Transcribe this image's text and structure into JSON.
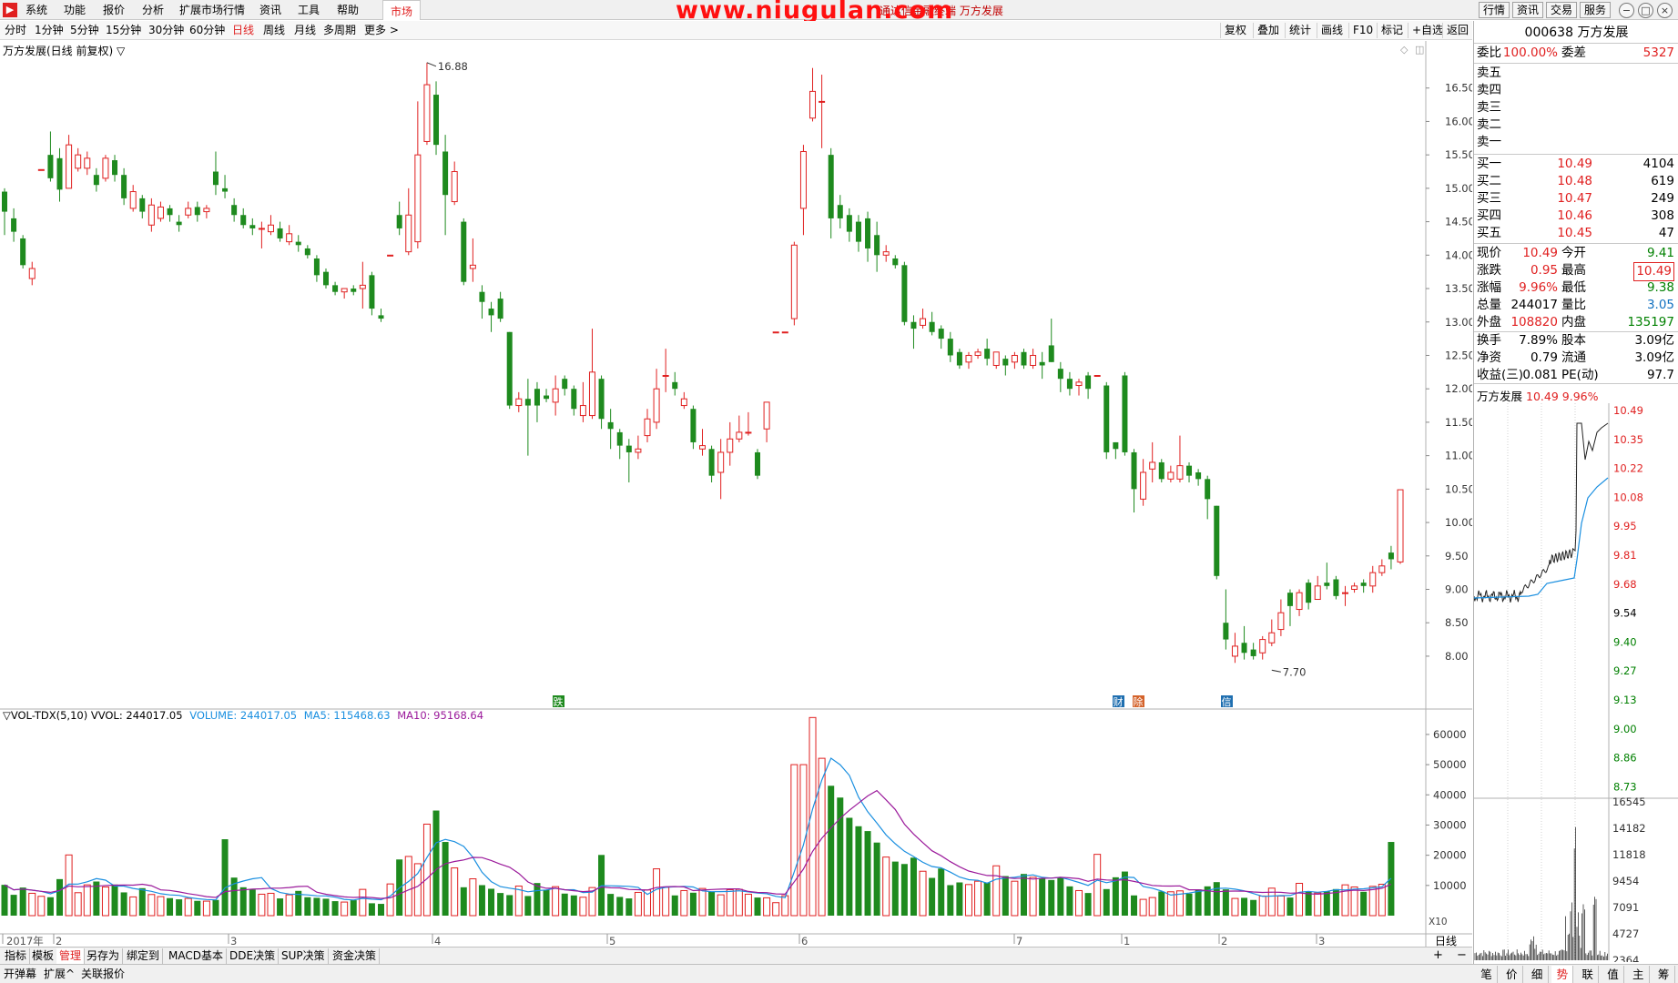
{
  "menubar": {
    "items": [
      "系统",
      "功能",
      "报价",
      "分析",
      "扩展市场行情",
      "资讯",
      "工具",
      "帮助"
    ],
    "market_tab": "市场",
    "watermark": "www.niugulan.com",
    "window_title": "通达信金融终端  万方发展",
    "right_buttons": [
      "行情",
      "资讯",
      "交易",
      "服务"
    ]
  },
  "periodbar": {
    "periods": [
      "分时",
      "1分钟",
      "5分钟",
      "15分钟",
      "30分钟",
      "60分钟",
      "日线",
      "周线",
      "月线",
      "多周期",
      "更多 >"
    ],
    "active": "日线",
    "tools": [
      "复权",
      "叠加",
      "统计",
      "画线",
      "F10",
      "标记",
      "+自选",
      "返回"
    ]
  },
  "chart": {
    "title": "万方发展(日线 前复权) ▽",
    "high_label": "16.88",
    "low_label": "7.70",
    "price_axis": [
      "16.50",
      "16.00",
      "15.50",
      "15.00",
      "14.50",
      "14.00",
      "13.50",
      "13.00",
      "12.50",
      "12.00",
      "11.50",
      "11.00",
      "10.50",
      "10.00",
      "9.50",
      "9.00",
      "8.50",
      "8.00"
    ],
    "volume_axis": [
      "60000",
      "50000",
      "40000",
      "30000",
      "20000",
      "10000"
    ],
    "volume_unit": "X10",
    "time_axis": [
      "2017年",
      "2",
      "3",
      "4",
      "5",
      "6",
      "7",
      "1",
      "2",
      "3"
    ],
    "period_label": "日线",
    "markers": [
      "跌",
      "财",
      "除",
      "信"
    ],
    "vol_legend": {
      "name": "▽VOL-TDX(5,10) VVOL: 244017.05",
      "volume": "VOLUME: 244017.05",
      "ma5": "MA5: 115468.63",
      "ma10": "MA10: 95168.64"
    }
  },
  "colors": {
    "up": "#e02020",
    "down": "#1e8a1e",
    "ma5": "#1a8fe0",
    "ma10": "#9b1a9b",
    "accent": "#e02020"
  },
  "chart_data": {
    "type": "candlestick",
    "title": "万方发展(日线 前复权)",
    "ylim": [
      7.4,
      17.0
    ],
    "vol_ylim": [
      0,
      66000
    ],
    "candles": [
      [
        14.95,
        14.65,
        15.0,
        14.3
      ],
      [
        14.55,
        14.35,
        14.7,
        14.2
      ],
      [
        14.25,
        13.85,
        14.3,
        13.8
      ],
      [
        13.65,
        13.8,
        13.9,
        13.55
      ],
      [
        15.28,
        15.28,
        15.28,
        15.28
      ],
      [
        15.5,
        15.15,
        15.85,
        15.1
      ],
      [
        15.45,
        14.98,
        15.6,
        14.8
      ],
      [
        15.0,
        15.65,
        15.8,
        15.0
      ],
      [
        15.3,
        15.5,
        15.6,
        15.25
      ],
      [
        15.3,
        15.45,
        15.55,
        15.2
      ],
      [
        15.2,
        15.05,
        15.3,
        14.95
      ],
      [
        15.15,
        15.45,
        15.5,
        15.1
      ],
      [
        15.42,
        15.2,
        15.5,
        15.1
      ],
      [
        15.2,
        14.85,
        15.3,
        14.75
      ],
      [
        14.7,
        14.95,
        15.05,
        14.65
      ],
      [
        14.85,
        14.65,
        14.9,
        14.55
      ],
      [
        14.45,
        14.75,
        14.85,
        14.35
      ],
      [
        14.55,
        14.72,
        14.8,
        14.5
      ],
      [
        14.7,
        14.6,
        14.75,
        14.5
      ],
      [
        14.5,
        14.45,
        14.6,
        14.35
      ],
      [
        14.6,
        14.7,
        14.8,
        14.55
      ],
      [
        14.72,
        14.6,
        14.8,
        14.5
      ],
      [
        14.65,
        14.7,
        14.75,
        14.55
      ],
      [
        15.25,
        15.05,
        15.55,
        14.9
      ],
      [
        15.0,
        14.95,
        15.2,
        14.85
      ],
      [
        14.75,
        14.6,
        14.85,
        14.5
      ],
      [
        14.6,
        14.45,
        14.7,
        14.4
      ],
      [
        14.45,
        14.4,
        14.55,
        14.3
      ],
      [
        14.4,
        14.4,
        14.5,
        14.1
      ],
      [
        14.35,
        14.45,
        14.6,
        14.3
      ],
      [
        14.4,
        14.25,
        14.5,
        14.2
      ],
      [
        14.2,
        14.32,
        14.45,
        14.15
      ],
      [
        14.2,
        14.15,
        14.3,
        14.05
      ],
      [
        14.1,
        14.0,
        14.15,
        13.95
      ],
      [
        13.95,
        13.7,
        14.0,
        13.6
      ],
      [
        13.75,
        13.55,
        13.8,
        13.5
      ],
      [
        13.55,
        13.45,
        13.6,
        13.4
      ],
      [
        13.45,
        13.5,
        13.5,
        13.35
      ],
      [
        13.5,
        13.45,
        13.55,
        13.4
      ],
      [
        13.5,
        13.55,
        13.9,
        13.2
      ],
      [
        13.7,
        13.2,
        13.75,
        13.1
      ],
      [
        13.1,
        13.05,
        13.2,
        13.0
      ],
      [
        14.0,
        14.0,
        14.0,
        14.0
      ],
      [
        14.6,
        14.4,
        14.8,
        14.3
      ],
      [
        14.05,
        14.6,
        15.0,
        14.0
      ],
      [
        14.2,
        15.5,
        16.3,
        14.1
      ],
      [
        15.7,
        16.55,
        16.88,
        15.65
      ],
      [
        16.4,
        15.65,
        16.6,
        15.5
      ],
      [
        15.55,
        14.9,
        15.8,
        14.3
      ],
      [
        14.8,
        15.25,
        15.4,
        14.75
      ],
      [
        14.5,
        13.6,
        14.55,
        13.55
      ],
      [
        13.8,
        13.85,
        14.25,
        13.6
      ],
      [
        13.45,
        13.3,
        13.55,
        13.05
      ],
      [
        13.2,
        13.1,
        13.3,
        12.85
      ],
      [
        13.35,
        13.05,
        13.45,
        13.0
      ],
      [
        12.85,
        11.75,
        12.85,
        11.7
      ],
      [
        11.75,
        11.85,
        11.95,
        11.65
      ],
      [
        11.85,
        11.75,
        12.15,
        11.0
      ],
      [
        12.0,
        11.75,
        12.1,
        11.5
      ],
      [
        11.9,
        11.85,
        12.0,
        11.8
      ],
      [
        11.8,
        12.0,
        12.2,
        11.6
      ],
      [
        12.15,
        12.0,
        12.2,
        11.9
      ],
      [
        12.0,
        11.7,
        12.05,
        11.6
      ],
      [
        11.6,
        11.75,
        12.1,
        11.5
      ],
      [
        11.6,
        12.25,
        12.9,
        11.55
      ],
      [
        12.15,
        11.55,
        12.2,
        11.4
      ],
      [
        11.5,
        11.4,
        11.7,
        11.1
      ],
      [
        11.35,
        11.15,
        11.4,
        10.95
      ],
      [
        11.15,
        11.05,
        11.25,
        10.6
      ],
      [
        11.05,
        11.1,
        11.3,
        10.95
      ],
      [
        11.3,
        11.55,
        11.7,
        11.2
      ],
      [
        11.5,
        12.0,
        12.3,
        11.4
      ],
      [
        12.2,
        12.2,
        12.6,
        11.95
      ],
      [
        12.1,
        12.0,
        12.25,
        11.9
      ],
      [
        11.75,
        11.85,
        11.95,
        11.7
      ],
      [
        11.7,
        11.2,
        11.75,
        11.1
      ],
      [
        11.1,
        11.15,
        11.4,
        11.0
      ],
      [
        11.1,
        10.7,
        11.15,
        10.6
      ],
      [
        10.75,
        11.05,
        11.25,
        10.35
      ],
      [
        11.05,
        11.25,
        11.5,
        10.85
      ],
      [
        11.25,
        11.35,
        11.6,
        11.2
      ],
      [
        11.35,
        11.35,
        11.65,
        11.3
      ],
      [
        11.05,
        10.7,
        11.1,
        10.65
      ],
      [
        11.4,
        11.8,
        11.8,
        11.2
      ],
      [
        12.85,
        12.85,
        12.85,
        12.85
      ],
      [
        12.85,
        12.85,
        12.85,
        12.85
      ],
      [
        13.05,
        14.15,
        14.2,
        12.95
      ],
      [
        14.7,
        15.55,
        15.65,
        14.3
      ],
      [
        16.05,
        16.45,
        16.8,
        16.0
      ],
      [
        16.3,
        16.3,
        16.7,
        15.6
      ],
      [
        15.5,
        14.55,
        15.6,
        14.25
      ],
      [
        14.75,
        14.55,
        14.9,
        14.4
      ],
      [
        14.6,
        14.35,
        14.7,
        14.2
      ],
      [
        14.5,
        14.2,
        14.6,
        14.05
      ],
      [
        14.55,
        14.1,
        14.65,
        13.9
      ],
      [
        14.3,
        14.0,
        14.5,
        13.75
      ],
      [
        14.0,
        14.05,
        14.15,
        13.9
      ],
      [
        13.95,
        13.85,
        14.0,
        13.8
      ],
      [
        13.85,
        13.0,
        13.9,
        12.95
      ],
      [
        13.0,
        12.9,
        13.1,
        12.6
      ],
      [
        12.95,
        13.05,
        13.2,
        12.9
      ],
      [
        13.0,
        12.85,
        13.15,
        12.8
      ],
      [
        12.9,
        12.75,
        12.95,
        12.6
      ],
      [
        12.75,
        12.5,
        12.85,
        12.4
      ],
      [
        12.55,
        12.35,
        12.6,
        12.3
      ],
      [
        12.4,
        12.5,
        12.55,
        12.3
      ],
      [
        12.5,
        12.55,
        12.6,
        12.45
      ],
      [
        12.6,
        12.45,
        12.75,
        12.35
      ],
      [
        12.35,
        12.55,
        12.55,
        12.3
      ],
      [
        12.45,
        12.35,
        12.5,
        12.2
      ],
      [
        12.4,
        12.5,
        12.55,
        12.3
      ],
      [
        12.55,
        12.35,
        12.6,
        12.3
      ],
      [
        12.35,
        12.5,
        12.6,
        12.3
      ],
      [
        12.4,
        12.35,
        12.55,
        12.15
      ],
      [
        12.65,
        12.4,
        13.05,
        12.4
      ],
      [
        12.3,
        12.15,
        12.4,
        11.95
      ],
      [
        12.15,
        12.0,
        12.25,
        11.9
      ],
      [
        12.05,
        12.1,
        12.15,
        11.9
      ],
      [
        12.2,
        12.0,
        12.25,
        11.85
      ],
      [
        12.2,
        12.2,
        12.2,
        12.2
      ],
      [
        12.05,
        11.05,
        12.1,
        10.95
      ],
      [
        11.2,
        11.1,
        11.2,
        10.95
      ],
      [
        12.2,
        11.05,
        12.25,
        11.0
      ],
      [
        11.05,
        10.5,
        11.1,
        10.15
      ],
      [
        10.35,
        10.75,
        10.95,
        10.25
      ],
      [
        10.8,
        10.9,
        11.2,
        10.6
      ],
      [
        10.9,
        10.65,
        10.95,
        10.6
      ],
      [
        10.65,
        10.75,
        10.85,
        10.6
      ],
      [
        10.65,
        10.85,
        11.3,
        10.6
      ],
      [
        10.85,
        10.7,
        10.9,
        10.6
      ],
      [
        10.75,
        10.65,
        10.8,
        10.55
      ],
      [
        10.65,
        10.35,
        10.7,
        10.05
      ],
      [
        10.25,
        9.2,
        10.25,
        9.15
      ],
      [
        8.5,
        8.25,
        9.0,
        8.1
      ],
      [
        8.0,
        8.15,
        8.35,
        7.9
      ],
      [
        8.2,
        8.05,
        8.45,
        7.95
      ],
      [
        8.1,
        8.0,
        8.2,
        7.95
      ],
      [
        8.05,
        8.25,
        8.3,
        7.95
      ],
      [
        8.2,
        8.35,
        8.55,
        8.15
      ],
      [
        8.4,
        8.65,
        8.85,
        8.3
      ],
      [
        8.95,
        8.75,
        9.0,
        8.45
      ],
      [
        8.7,
        8.95,
        9.0,
        8.6
      ],
      [
        9.1,
        8.8,
        9.15,
        8.7
      ],
      [
        8.85,
        9.05,
        9.2,
        8.85
      ],
      [
        9.1,
        9.05,
        9.4,
        9.0
      ],
      [
        9.15,
        8.9,
        9.2,
        8.85
      ],
      [
        8.95,
        8.95,
        9.05,
        8.75
      ],
      [
        9.0,
        9.05,
        9.1,
        8.95
      ],
      [
        9.1,
        9.05,
        9.15,
        8.95
      ],
      [
        9.05,
        9.25,
        9.35,
        8.95
      ],
      [
        9.25,
        9.35,
        9.45,
        9.2
      ],
      [
        9.55,
        9.45,
        9.65,
        9.3
      ],
      [
        9.41,
        10.49,
        10.49,
        9.38
      ]
    ],
    "volumes": [
      10200,
      6900,
      9300,
      7400,
      6400,
      6100,
      12100,
      20100,
      7600,
      10200,
      11300,
      9500,
      10300,
      7700,
      6200,
      9100,
      7000,
      6300,
      5800,
      5400,
      5700,
      4900,
      4800,
      5200,
      25300,
      12600,
      9400,
      8600,
      7100,
      7400,
      5700,
      6900,
      8200,
      6100,
      5900,
      5600,
      4800,
      4500,
      5100,
      8700,
      4100,
      3900,
      10500,
      18600,
      19600,
      17200,
      30300,
      34800,
      24400,
      15800,
      9400,
      12200,
      10100,
      8900,
      7500,
      6800,
      9800,
      6500,
      10800,
      8600,
      9600,
      7300,
      6700,
      6100,
      9300,
      20100,
      7200,
      6200,
      5700,
      7700,
      8500,
      15500,
      9400,
      6700,
      8300,
      7600,
      9000,
      8000,
      6900,
      8600,
      8700,
      7100,
      6000,
      5900,
      4300,
      6600,
      50000,
      50000,
      65600,
      52100,
      43000,
      39100,
      32400,
      29600,
      28000,
      24200,
      19400,
      17900,
      17100,
      19200,
      14700,
      12500,
      15600,
      10100,
      11000,
      10300,
      11400,
      11000,
      16500,
      13100,
      11400,
      13800,
      12700,
      12400,
      11800,
      12800,
      9700,
      8300,
      7500,
      20300,
      8800,
      12700,
      14600,
      6700,
      5400,
      6000,
      8000,
      7900,
      8200,
      7300,
      8700,
      9700,
      11100,
      8700,
      5700,
      5900,
      5200,
      6500,
      9100,
      6500,
      6000,
      10700,
      8000,
      7500,
      8000,
      8800,
      10200,
      9500,
      7900,
      9700,
      10400,
      24400
    ]
  },
  "quote": {
    "code": "000638",
    "name": "万方发展",
    "weibi_label": "委比",
    "weibi": "100.00%",
    "weicha_label": "委差",
    "weicha": "5327",
    "sell": [
      {
        "label": "卖五",
        "price": "",
        "vol": ""
      },
      {
        "label": "卖四",
        "price": "",
        "vol": ""
      },
      {
        "label": "卖三",
        "price": "",
        "vol": ""
      },
      {
        "label": "卖二",
        "price": "",
        "vol": ""
      },
      {
        "label": "卖一",
        "price": "",
        "vol": ""
      }
    ],
    "buy": [
      {
        "label": "买一",
        "price": "10.49",
        "vol": "4104"
      },
      {
        "label": "买二",
        "price": "10.48",
        "vol": "619"
      },
      {
        "label": "买三",
        "price": "10.47",
        "vol": "249"
      },
      {
        "label": "买四",
        "price": "10.46",
        "vol": "308"
      },
      {
        "label": "买五",
        "price": "10.45",
        "vol": "47"
      }
    ],
    "stats": [
      {
        "l1": "现价",
        "v1": "10.49",
        "c1": "red",
        "l2": "今开",
        "v2": "9.41",
        "c2": "green"
      },
      {
        "l1": "涨跌",
        "v1": "0.95",
        "c1": "red",
        "l2": "最高",
        "v2": "10.49",
        "c2": "red"
      },
      {
        "l1": "涨幅",
        "v1": "9.96%",
        "c1": "red",
        "l2": "最低",
        "v2": "9.38",
        "c2": "green"
      },
      {
        "l1": "总量",
        "v1": "244017",
        "c1": "",
        "l2": "量比",
        "v2": "3.05",
        "c2": "blue"
      },
      {
        "l1": "外盘",
        "v1": "108820",
        "c1": "red",
        "l2": "内盘",
        "v2": "135197",
        "c2": "green"
      }
    ],
    "stats2": [
      {
        "l1": "换手",
        "v1": "7.89%",
        "l2": "股本",
        "v2": "3.09亿"
      },
      {
        "l1": "净资",
        "v1": "0.79",
        "l2": "流通",
        "v2": "3.09亿"
      },
      {
        "l1": "收益(三)",
        "v1": "0.081",
        "l2": "PE(动)",
        "v2": "97.7"
      }
    ],
    "mini_title": "万方发展",
    "mini_price": "10.49",
    "mini_pct": "9.96%",
    "mini_price_axis": [
      "10.49",
      "10.35",
      "10.22",
      "10.08",
      "9.95",
      "9.81",
      "9.68",
      "9.54",
      "9.40",
      "9.27",
      "9.13",
      "9.00",
      "8.86",
      "8.73"
    ],
    "mini_vol_axis": [
      "16545",
      "14182",
      "11818",
      "9454",
      "7091",
      "4727",
      "2364"
    ],
    "side_tabs": [
      "笔",
      "价",
      "细",
      "势",
      "联",
      "值",
      "主",
      "筹"
    ],
    "side_active": "势"
  },
  "bottom": {
    "tabs": [
      "指标",
      "模板",
      "管理",
      "另存为",
      "绑定到",
      "MACD基本",
      "DDE决策",
      "SUP决策",
      "资金决策"
    ],
    "active_tab": "管理",
    "status": [
      "开弹幕",
      "扩展^",
      "关联报价"
    ]
  }
}
